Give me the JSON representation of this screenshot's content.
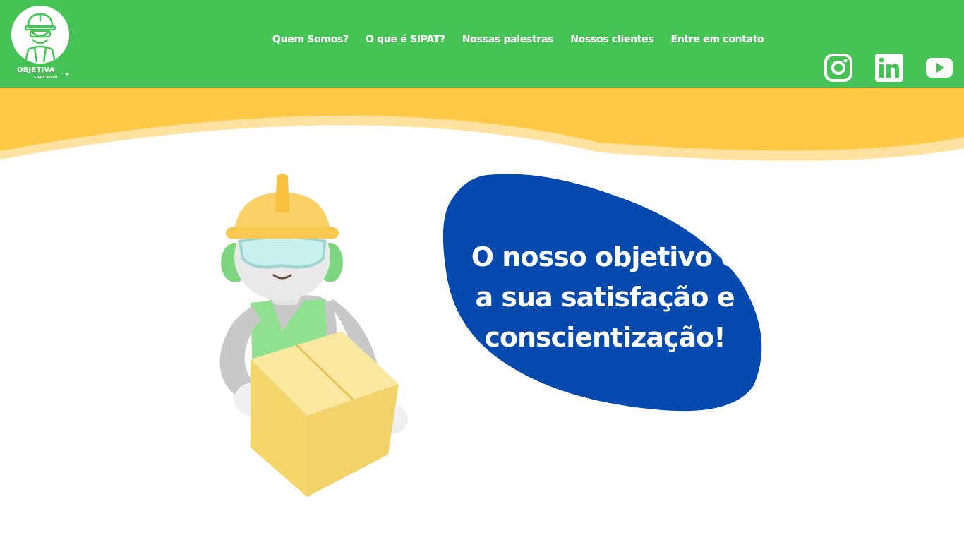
{
  "brand": {
    "logo_text": "OBJETIVA",
    "logo_subtext": "SIPAT Brasil",
    "colors": {
      "header_green": "#45c455",
      "wave_yellow": "#ffc845",
      "wave_light": "#ffe1a0",
      "blob_blue": "#0449ad",
      "text_white": "#ffffff"
    }
  },
  "nav": {
    "items": [
      {
        "label": "Quem Somos?"
      },
      {
        "label": "O que é SIPAT?"
      },
      {
        "label": "Nossas palestras"
      },
      {
        "label": "Nossos clientes"
      },
      {
        "label": "Entre em contato"
      }
    ]
  },
  "social": {
    "icons": [
      "instagram-icon",
      "linkedin-icon",
      "youtube-icon"
    ]
  },
  "hero": {
    "headline_line1": "O nosso objetivo é",
    "headline_line2": "a sua satisfação e",
    "headline_line3": "conscientização!"
  }
}
